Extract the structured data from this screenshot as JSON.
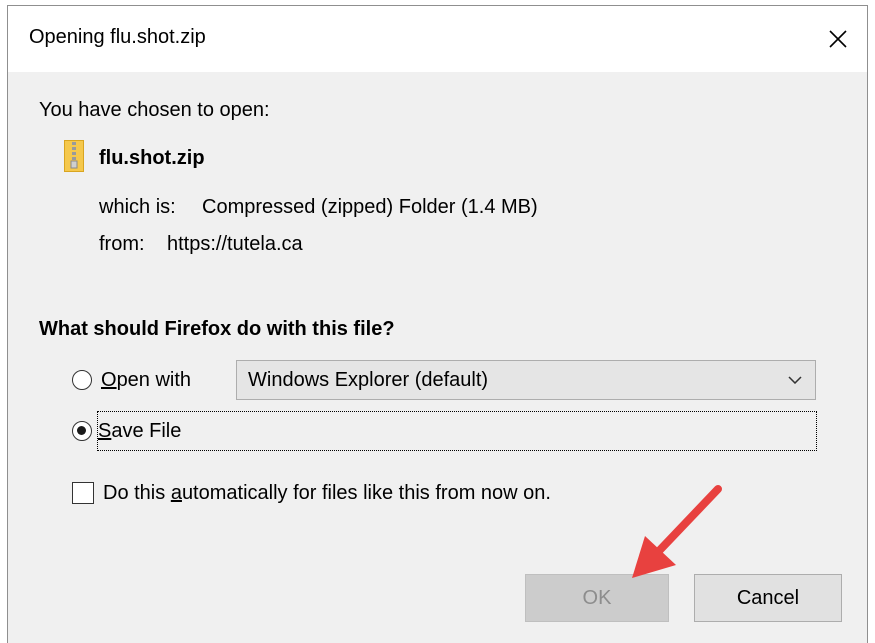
{
  "dialog": {
    "title": "Opening flu.shot.zip",
    "close_icon": "close-icon"
  },
  "file": {
    "chosen_label": "You have chosen to open:",
    "name": "flu.shot.zip",
    "icon": "zip-folder-icon",
    "which_label": "which is:",
    "which_value": "Compressed (zipped) Folder (1.4 MB)",
    "from_label": "from:",
    "from_value": "https://tutela.ca"
  },
  "action": {
    "question": "What should Firefox do with this file?",
    "open_with": {
      "mnemonic": "O",
      "label_rest": "pen with",
      "selected": false
    },
    "app_select": {
      "value": "Windows Explorer (default)",
      "chevron_icon": "chevron-down-icon"
    },
    "save_file": {
      "mnemonic": "S",
      "label_rest": "ave File",
      "selected": true
    },
    "auto": {
      "label_before": "Do this ",
      "mnemonic": "a",
      "label_after": "utomatically for files like this from now on.",
      "checked": false
    }
  },
  "buttons": {
    "ok_label": "OK",
    "ok_enabled": false,
    "cancel_label": "Cancel"
  },
  "annotation": {
    "arrow_color": "#e8413f"
  }
}
